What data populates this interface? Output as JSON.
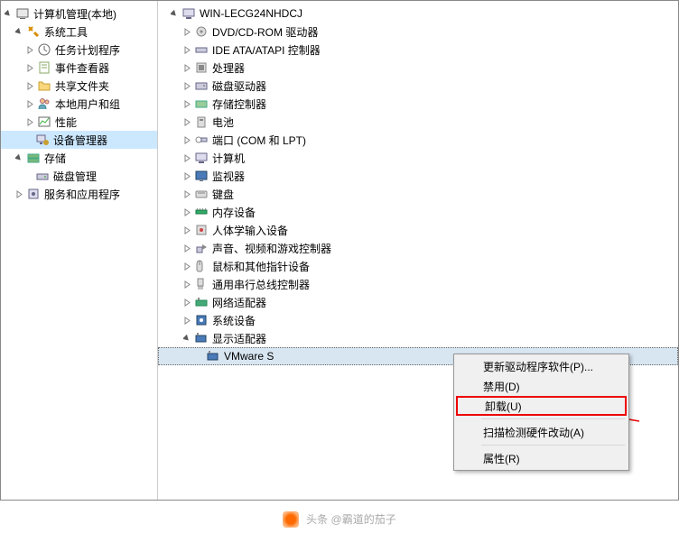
{
  "leftTree": {
    "root": "计算机管理(本地)",
    "group1": {
      "label": "系统工具",
      "items": [
        "任务计划程序",
        "事件查看器",
        "共享文件夹",
        "本地用户和组",
        "性能",
        "设备管理器"
      ]
    },
    "group2": {
      "label": "存储",
      "items": [
        "磁盘管理"
      ]
    },
    "group3": {
      "label": "服务和应用程序"
    }
  },
  "rightTree": {
    "root": "WIN-LECG24NHDCJ",
    "categories": [
      "DVD/CD-ROM 驱动器",
      "IDE ATA/ATAPI 控制器",
      "处理器",
      "磁盘驱动器",
      "存储控制器",
      "电池",
      "端口 (COM 和 LPT)",
      "计算机",
      "监视器",
      "键盘",
      "内存设备",
      "人体学输入设备",
      "声音、视频和游戏控制器",
      "鼠标和其他指针设备",
      "通用串行总线控制器",
      "网络适配器",
      "系统设备"
    ],
    "displayAdapters": {
      "label": "显示适配器",
      "device": "VMware S"
    }
  },
  "contextMenu": {
    "items": [
      "更新驱动程序软件(P)...",
      "禁用(D)",
      "卸载(U)",
      "扫描检测硬件改动(A)",
      "属性(R)"
    ]
  },
  "watermark": "头条 @霸道的茄子"
}
